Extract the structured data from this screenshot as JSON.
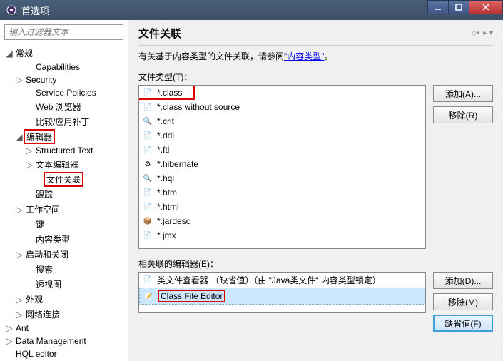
{
  "window": {
    "title": "首选项"
  },
  "filter": {
    "placeholder": "输入过滤器文本"
  },
  "tree": {
    "general": "常规",
    "capabilities": "Capabilities",
    "security": "Security",
    "service_policies": "Service Policies",
    "web_browser": "Web 浏览器",
    "compare": "比较/应用补丁",
    "editors": "编辑器",
    "structured_text": "Structured Text",
    "text_editors": "文本编辑器",
    "file_assoc": "文件关联",
    "trace": "跟踪",
    "workspace": "工作空间",
    "keys": "键",
    "content_types": "内容类型",
    "startup": "启动和关闭",
    "search": "搜索",
    "perspectives": "透视图",
    "appearance": "外观",
    "network": "网络连接",
    "ant": "Ant",
    "data_mgmt": "Data Management",
    "hql": "HQL editor"
  },
  "header": {
    "title": "文件关联"
  },
  "desc": {
    "text": "有关基于内容类型的文件关联，请参阅",
    "link": "\"内容类型\"",
    "tail": "。"
  },
  "labels": {
    "file_types": "文件类型(T)：",
    "assoc_editors": "相关联的编辑器(E)："
  },
  "file_types": [
    {
      "ext": "*.class",
      "icon": "class"
    },
    {
      "ext": "*.class without source",
      "icon": "class"
    },
    {
      "ext": "*.crit",
      "icon": "search"
    },
    {
      "ext": "*.ddl",
      "icon": "file"
    },
    {
      "ext": "*.ftl",
      "icon": "file"
    },
    {
      "ext": "*.hibernate",
      "icon": "gear"
    },
    {
      "ext": "*.hql",
      "icon": "search"
    },
    {
      "ext": "*.htm",
      "icon": "file"
    },
    {
      "ext": "*.html",
      "icon": "file"
    },
    {
      "ext": "*.jardesc",
      "icon": "jar"
    },
    {
      "ext": "*.jmx",
      "icon": "file"
    }
  ],
  "editors": [
    {
      "name": "类文件查看器 （缺省值）（由 \"Java类文件\" 内容类型锁定）",
      "icon": "class"
    },
    {
      "name": "Class File Editor",
      "icon": "editor"
    }
  ],
  "buttons": {
    "add_a": "添加(A)...",
    "remove_r": "移除(R)",
    "add_d": "添加(D)...",
    "remove_m": "移除(M)",
    "default_f": "缺省值(F)"
  }
}
